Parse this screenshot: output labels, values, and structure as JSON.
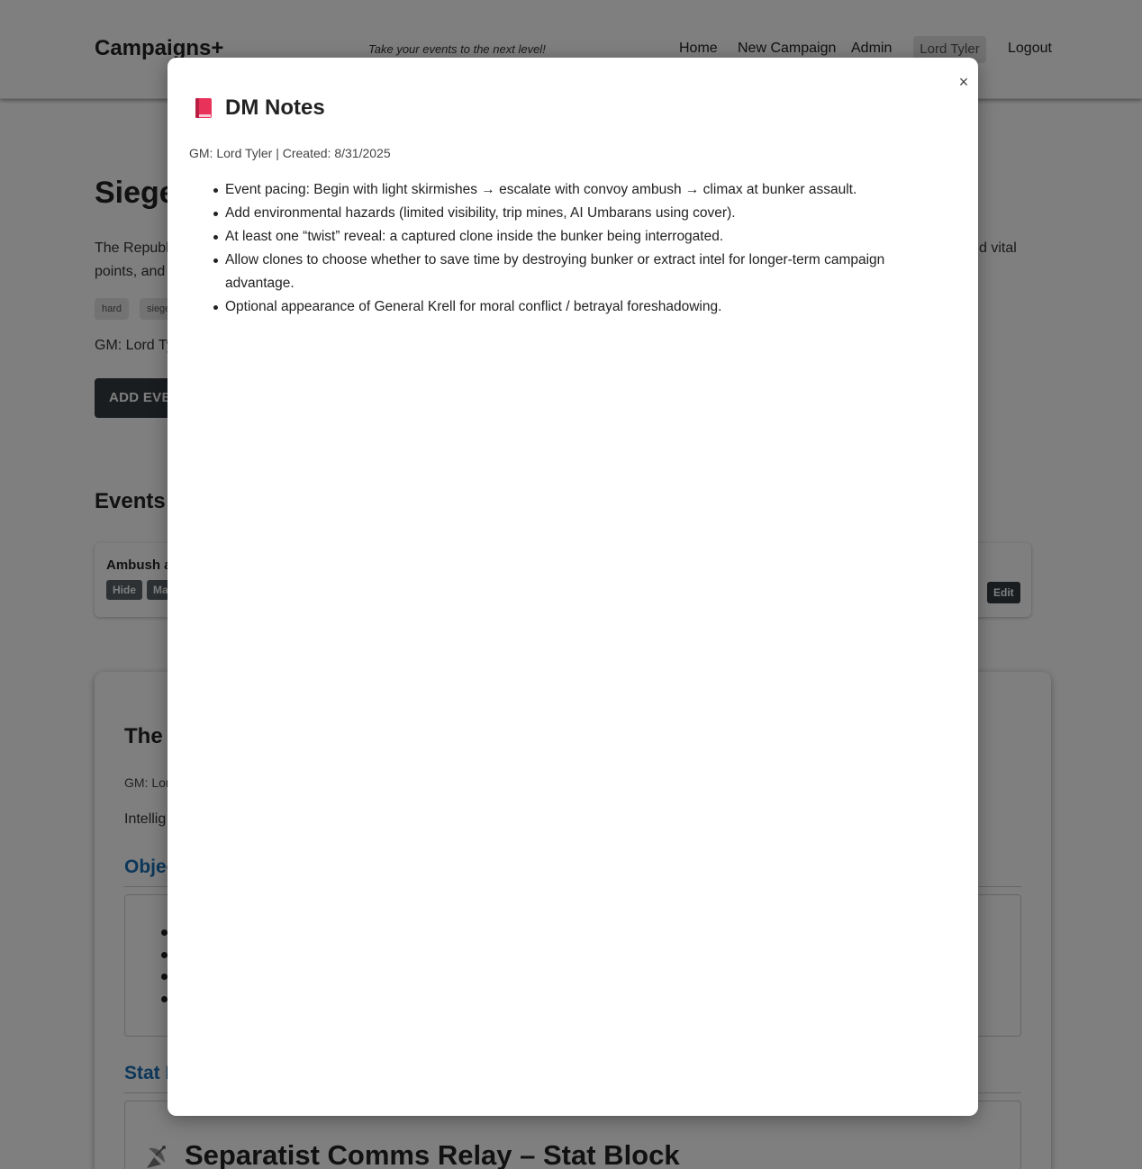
{
  "navbar": {
    "brand": "Campaigns+",
    "tagline": "Take your events to the next level!",
    "links": [
      "Home",
      "New Campaign",
      "Admin"
    ],
    "user": "Lord Tyler",
    "logout": "Logout"
  },
  "page": {
    "title_partial": "Siege",
    "description_start": "The Republ",
    "description_line2": "points, and",
    "description_end": "d vital",
    "tags": [
      "hard",
      "siege"
    ],
    "gm_partial": "GM: Lord Ty",
    "add_event_partial": "ADD EVEN",
    "events_heading": "Events",
    "event_name_partial": "Ambush a",
    "event_buttons": {
      "hide": "Hide",
      "ma": "Ma",
      "edit": "Edit"
    }
  },
  "detail": {
    "title_partial": "The",
    "gm_partial": "GM: Lor",
    "intel_partial": "Intellig",
    "objectives_heading_partial": "Objec",
    "stat_heading_partial": "Stat B",
    "stat_block_title": "Separatist Comms Relay – Stat Block"
  },
  "modal": {
    "title": "DM Notes",
    "meta": "GM: Lord Tyler | Created: 8/31/2025",
    "close_symbol": "×",
    "notes": [
      "Event pacing: Begin with light skirmishes → escalate with convoy ambush → climax at bunker assault.",
      "Add environmental hazards (limited visibility, trip mines, AI Umbarans using cover).",
      "At least one “twist” reveal: a captured clone inside the bunker being interrogated.",
      "Allow clones to choose whether to save time by destroying bunker or extract intel for longer-term campaign advantage.",
      "Optional appearance of General Krell for moral conflict / betrayal foreshadowing."
    ]
  },
  "colors": {
    "overlay": "rgba(0,0,0,0.5)",
    "section_heading": "#1a6fb5",
    "dark_button": "#343a40",
    "book_icon": "#e8325a"
  }
}
